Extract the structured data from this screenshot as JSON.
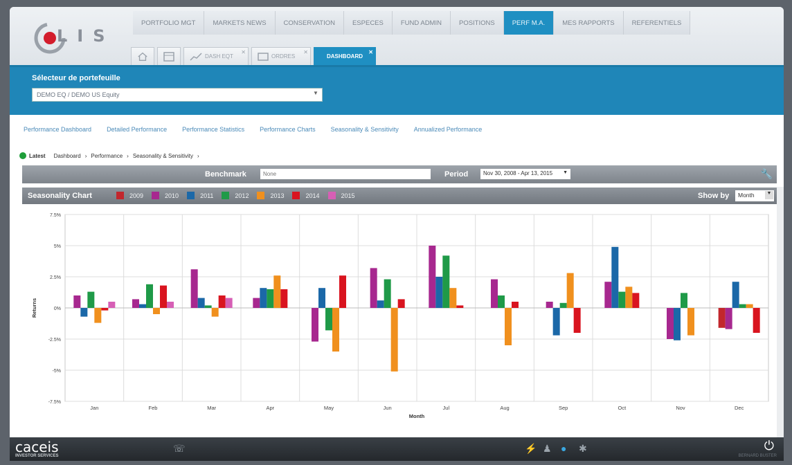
{
  "app": {
    "logo_text": "LIS"
  },
  "topnav": [
    {
      "label": "PORTFOLIO MGT",
      "active": false
    },
    {
      "label": "MARKETS NEWS",
      "active": false
    },
    {
      "label": "CONSERVATION",
      "active": false
    },
    {
      "label": "ESPECES",
      "active": false
    },
    {
      "label": "FUND ADMIN",
      "active": false
    },
    {
      "label": "POSITIONS",
      "active": false
    },
    {
      "label": "PERF M.A.",
      "active": true
    },
    {
      "label": "MES RAPPORTS",
      "active": false
    },
    {
      "label": "REFERENTIELS",
      "active": false
    }
  ],
  "subtabs": {
    "home_icon": "home-icon",
    "calc_icon": "calculator-icon",
    "tab1": "DASH EQT",
    "tab2": "ORDRES",
    "tab3": "DASHBOARD"
  },
  "selector": {
    "label": "Sélecteur de portefeuille",
    "value": "DEMO EQ / DEMO US Equity"
  },
  "perf_nav": [
    "Performance Dashboard",
    "Detailed Performance",
    "Performance Statistics",
    "Performance Charts",
    "Seasonality & Sensitivity",
    "Annualized Performance"
  ],
  "breadcrumb": {
    "latest": "Latest",
    "items": [
      "Dashboard",
      "Performance",
      "Seasonality & Sensitivity"
    ]
  },
  "benchmark": {
    "label": "Benchmark",
    "placeholder": "None",
    "period_label": "Period",
    "period_value": "Nov 30, 2008 - Apr 13, 2015"
  },
  "seasonality": {
    "title": "Seasonality Chart",
    "show_by_label": "Show by",
    "show_by_value": "Month"
  },
  "colors": {
    "2009": "#c2272d",
    "2010": "#a7288f",
    "2011": "#1b68a8",
    "2012": "#1f9a48",
    "2013": "#f0901e",
    "2014": "#d9141f",
    "2015": "#d65fb5"
  },
  "chart_data": {
    "type": "bar",
    "xlabel": "Month",
    "ylabel": "Returns",
    "ylim": [
      -7.5,
      7.5
    ],
    "yticks": [
      "7.5%",
      "5%",
      "2.5%",
      "0%",
      "-2.5%",
      "-5%",
      "-7.5%"
    ],
    "categories": [
      "Jan",
      "Feb",
      "Mar",
      "Apr",
      "May",
      "Jun",
      "Jul",
      "Aug",
      "Sep",
      "Oct",
      "Nov",
      "Dec"
    ],
    "series": [
      {
        "name": "2009",
        "values": [
          null,
          null,
          null,
          null,
          null,
          null,
          null,
          null,
          null,
          null,
          null,
          -1.6
        ]
      },
      {
        "name": "2010",
        "values": [
          1.0,
          0.7,
          3.1,
          0.8,
          -2.7,
          3.2,
          5.0,
          2.3,
          0.5,
          2.1,
          -2.5,
          -1.7
        ]
      },
      {
        "name": "2011",
        "values": [
          -0.7,
          0.3,
          0.8,
          1.6,
          1.6,
          0.6,
          2.5,
          null,
          -2.2,
          4.9,
          -2.6,
          2.1
        ]
      },
      {
        "name": "2012",
        "values": [
          1.3,
          1.9,
          0.2,
          1.5,
          -1.8,
          2.3,
          4.2,
          1.0,
          0.4,
          1.3,
          1.2,
          0.3
        ]
      },
      {
        "name": "2013",
        "values": [
          -1.2,
          -0.5,
          -0.7,
          2.6,
          -3.5,
          -5.1,
          1.6,
          -3.0,
          2.8,
          1.7,
          -2.2,
          0.3
        ]
      },
      {
        "name": "2014",
        "values": [
          -0.2,
          1.8,
          1.0,
          1.5,
          2.6,
          0.7,
          0.2,
          0.5,
          -2.0,
          1.2,
          null,
          -2.0
        ]
      },
      {
        "name": "2015",
        "values": [
          0.5,
          0.5,
          0.8,
          null,
          null,
          null,
          null,
          null,
          null,
          null,
          null,
          null
        ]
      }
    ]
  },
  "bottombar": {
    "brand": "caceis",
    "brand_sub": "INVESTOR SERVICES",
    "user": "BERNARD BUSTER"
  }
}
